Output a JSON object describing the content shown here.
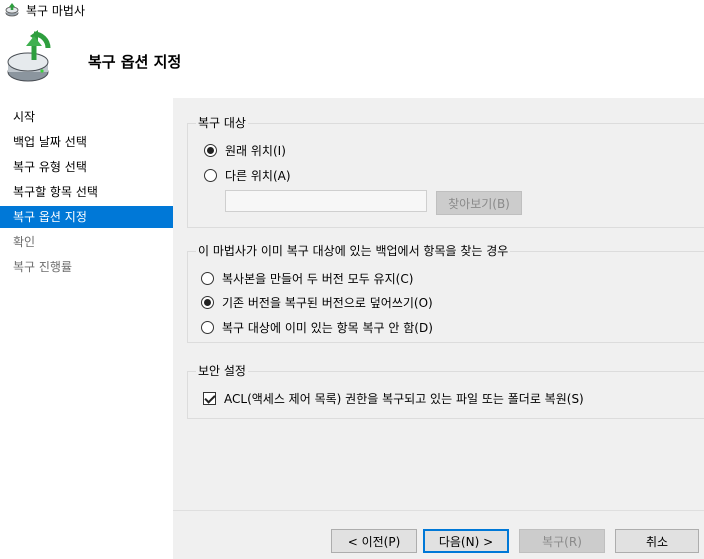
{
  "window": {
    "title": "복구 마법사"
  },
  "header": {
    "title": "복구 옵션 지정"
  },
  "sidebar": {
    "items": [
      {
        "label": "시작"
      },
      {
        "label": "백업 날짜 선택"
      },
      {
        "label": "복구 유형 선택"
      },
      {
        "label": "복구할 항목 선택"
      },
      {
        "label": "복구 옵션 지정"
      },
      {
        "label": "확인"
      },
      {
        "label": "복구 진행률"
      }
    ],
    "selected": "복구 옵션 지정"
  },
  "recovery_target": {
    "legend": "복구 대상",
    "original_label": "원래 위치(I)",
    "other_label": "다른 위치(A)",
    "selected": "원래 위치(I)",
    "path_value": "",
    "browse_label": "찾아보기(B)"
  },
  "conflict": {
    "legend": "이 마법사가 이미 복구 대상에 있는 백업에서 항목을 찾는 경우",
    "options": [
      {
        "label": "복사본을 만들어 두 버전 모두 유지(C)"
      },
      {
        "label": "기존 버전을 복구된 버전으로 덮어쓰기(O)"
      },
      {
        "label": "복구 대상에 이미 있는 항목 복구 안 함(D)"
      }
    ],
    "selected": "기존 버전을 복구된 버전으로 덮어쓰기(O)"
  },
  "security": {
    "legend": "보안 설정",
    "acl_label": "ACL(액세스 제어 목록) 권한을 복구되고 있는 파일 또는 폴더로 복원(S)",
    "acl_checked": true
  },
  "footer": {
    "back_label": "< 이전(P)",
    "next_label": "다음(N) >",
    "recover_label": "복구(R)",
    "cancel_label": "취소"
  },
  "colors": {
    "selection": "#0078d7",
    "disabled_text": "#6d6d6d"
  }
}
